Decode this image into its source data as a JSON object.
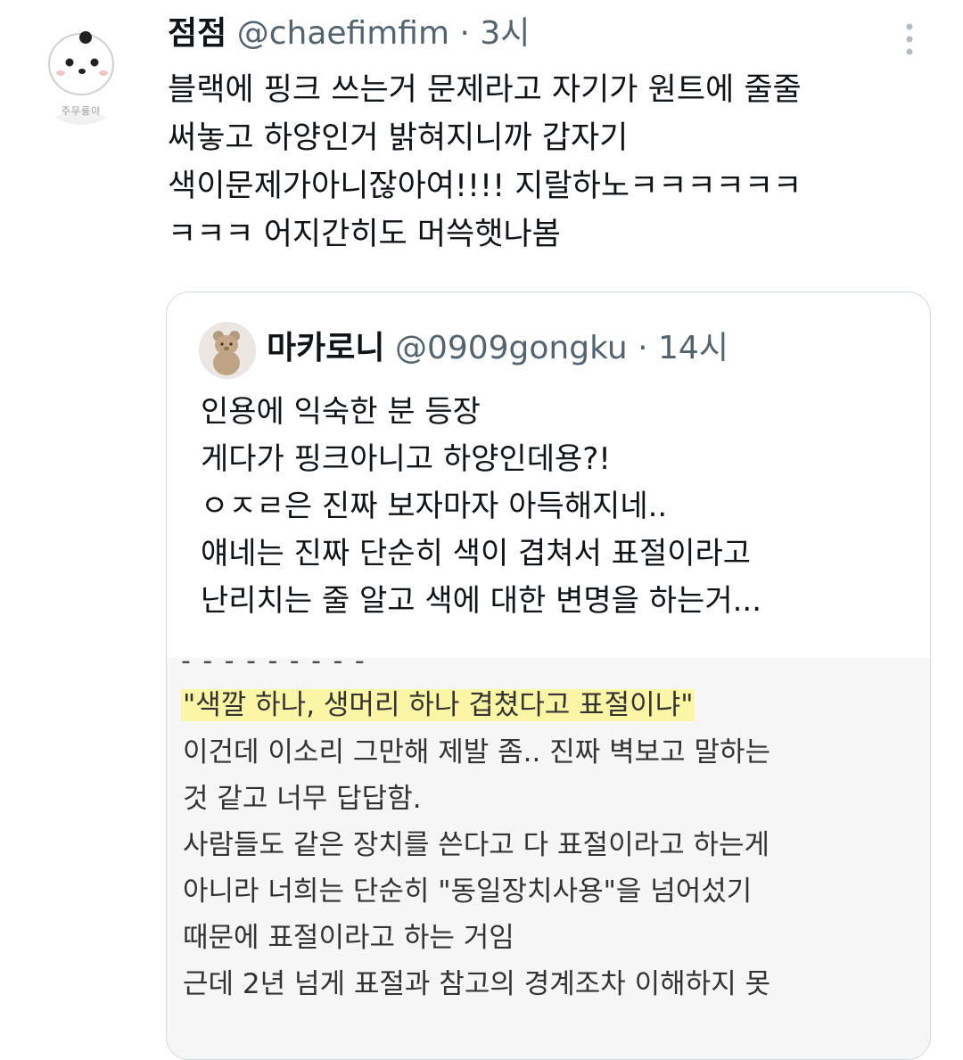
{
  "tweet": {
    "display_name": "점점",
    "handle": "@chaefimfim",
    "separator": "·",
    "time": "3시",
    "text": "블랙에 핑크 쓰는거 문제라고 자기가 원트에 줄줄\n써놓고 하양인거 밝혀지니까 갑자기\n색이문제가아니잖아여!!!! 지랄하노ㅋㅋㅋㅋㅋㅋ\nㅋㅋㅋ 어지간히도 머쓱햇나봄",
    "avatar_caption": "주무룽야",
    "avatar_icon": "cartoon-face-avatar",
    "more_icon": "vertical-ellipsis-icon"
  },
  "quote": {
    "display_name": "마카로니",
    "handle": "@0909gongku",
    "separator": "·",
    "time": "14시",
    "avatar_icon": "bear-plush-avatar",
    "text": "인용에 익숙한 분 등장\n게다가 핑크아니고 하양인데용?!\nㅇㅈㄹ은 진짜 보자마자 아득해지네..\n얘네는 진짜 단순히 색이 겹쳐서 표절이라고\n난리치는 줄 알고 색에 대한 변명을 하는거...",
    "image": {
      "cut_top_line": "- - - - - - - - -",
      "highlight_line": "\"색깔 하나, 생머리 하나 겹쳤다고 표절이냐\"",
      "lines": "이건데 이소리 그만해 제발 좀.. 진짜 벽보고 말하는\n것 같고 너무 답답함.\n사람들도 같은 장치를 쓴다고 다 표절이라고 하는게\n아니라 너희는 단순히 \"동일장치사용\"을 넘어섰기\n때문에 표절이라고 하는 거임\n근데 2년 넘게 표절과 참고의 경계조차 이해하지 못",
      "highlight_color": "#fbf6a5"
    }
  },
  "colors": {
    "text": "#0f1419",
    "secondary": "#536471",
    "border": "#cfd9de"
  }
}
